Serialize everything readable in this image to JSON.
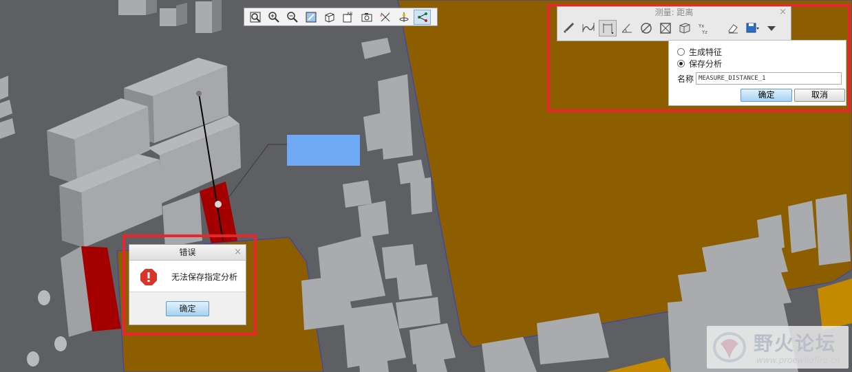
{
  "viewport": {
    "background": "#5d5f63",
    "component_color": "#a8aaad",
    "board_color": "#8c5e00",
    "highlight_color": "#a50000",
    "note_color": "#6fa8f5"
  },
  "view_toolbar": {
    "buttons": [
      "refit-icon",
      "zoom-in-icon",
      "zoom-out-icon",
      "repaint-icon",
      "display-style-icon",
      "saved-views-icon",
      "camera-icon",
      "datum-display-icon",
      "spin-center-icon",
      "annotation-display-icon"
    ]
  },
  "measure_dialog": {
    "title": "测量: 距离",
    "close": "×",
    "tools": [
      "summary-icon",
      "length-icon",
      "distance-icon",
      "angle-icon",
      "diameter-icon",
      "area-icon",
      "volume-icon",
      "transform-icon",
      "eraser-icon",
      "save-icon",
      "more-icon"
    ],
    "option_generate": "生成特征",
    "option_save": "保存分析",
    "name_label": "名称",
    "name_value": "MEASURE_DISTANCE_1",
    "ok_label": "确定",
    "cancel_label": "取消"
  },
  "error_dialog": {
    "title": "错误",
    "close": "×",
    "message": "无法保存指定分析",
    "ok_label": "确定"
  },
  "watermark": {
    "name": "野火论坛",
    "url": "www.proewildfire.cn"
  }
}
